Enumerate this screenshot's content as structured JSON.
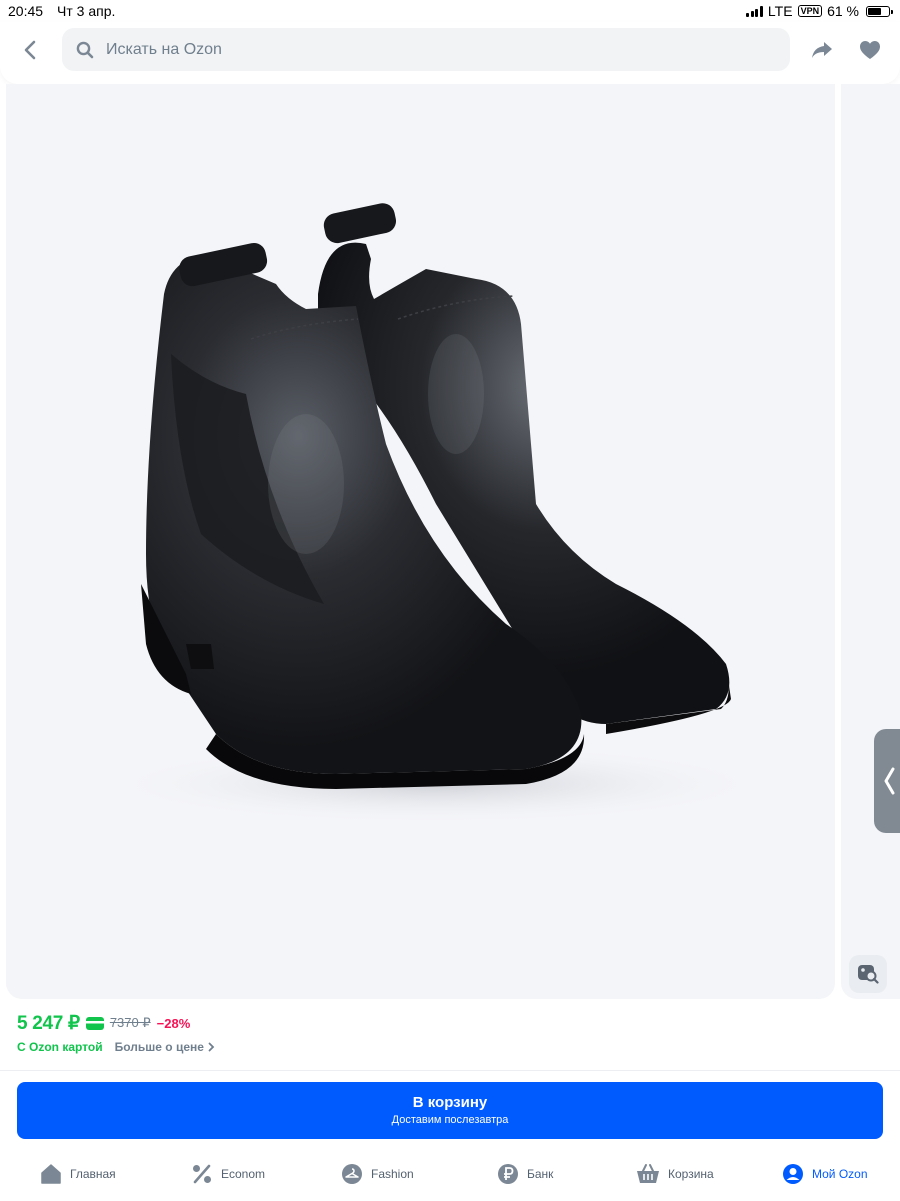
{
  "status_bar": {
    "time": "20:45",
    "date": "Чт 3 апр.",
    "network": "LTE",
    "vpn": "VPN",
    "battery": "61 %",
    "battery_level": 0.61
  },
  "header": {
    "search_placeholder": "Искать на Ozon",
    "back_icon": "chevron-left-icon",
    "share_icon": "share-icon",
    "favorite_icon": "heart-icon"
  },
  "gallery": {
    "image_alt": "black-leather-chelsea-boots",
    "side_handle_icon": "chevron-left-icon",
    "visual_search_icon": "image-search-icon"
  },
  "price": {
    "current": "5 247 ₽",
    "old": "7370 ₽",
    "discount": "−28%",
    "card_label": "С Ozon картой",
    "more_label": "Больше о цене"
  },
  "cart_button": {
    "label": "В корзину",
    "sublabel": "Доставим послезавтра"
  },
  "tabbar": {
    "items": [
      {
        "label": "Главная",
        "icon": "home-icon"
      },
      {
        "label": "Econom",
        "icon": "percent-icon"
      },
      {
        "label": "Fashion",
        "icon": "hanger-icon"
      },
      {
        "label": "Банк",
        "icon": "ruble-icon"
      },
      {
        "label": "Корзина",
        "icon": "basket-icon"
      },
      {
        "label": "Мой Ozon",
        "icon": "profile-icon"
      }
    ]
  },
  "colors": {
    "accent": "#005bff",
    "price_green": "#10c44c",
    "discount_pink": "#f91155",
    "text": "#001a34",
    "muted": "#707f8d"
  }
}
